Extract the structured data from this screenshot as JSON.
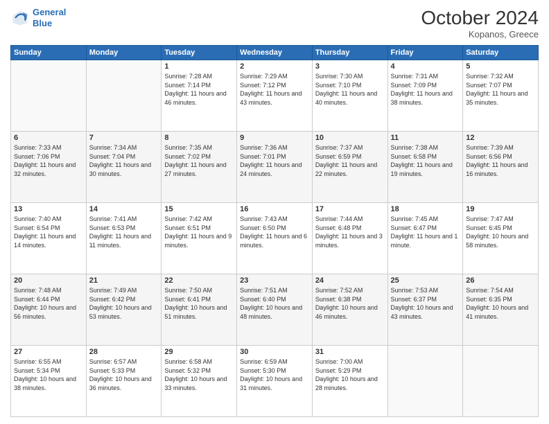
{
  "header": {
    "logo_line1": "General",
    "logo_line2": "Blue",
    "month_title": "October 2024",
    "location": "Kopanos, Greece"
  },
  "days_of_week": [
    "Sunday",
    "Monday",
    "Tuesday",
    "Wednesday",
    "Thursday",
    "Friday",
    "Saturday"
  ],
  "weeks": [
    [
      {
        "day": "",
        "info": ""
      },
      {
        "day": "",
        "info": ""
      },
      {
        "day": "1",
        "info": "Sunrise: 7:28 AM\nSunset: 7:14 PM\nDaylight: 11 hours and 46 minutes."
      },
      {
        "day": "2",
        "info": "Sunrise: 7:29 AM\nSunset: 7:12 PM\nDaylight: 11 hours and 43 minutes."
      },
      {
        "day": "3",
        "info": "Sunrise: 7:30 AM\nSunset: 7:10 PM\nDaylight: 11 hours and 40 minutes."
      },
      {
        "day": "4",
        "info": "Sunrise: 7:31 AM\nSunset: 7:09 PM\nDaylight: 11 hours and 38 minutes."
      },
      {
        "day": "5",
        "info": "Sunrise: 7:32 AM\nSunset: 7:07 PM\nDaylight: 11 hours and 35 minutes."
      }
    ],
    [
      {
        "day": "6",
        "info": "Sunrise: 7:33 AM\nSunset: 7:06 PM\nDaylight: 11 hours and 32 minutes."
      },
      {
        "day": "7",
        "info": "Sunrise: 7:34 AM\nSunset: 7:04 PM\nDaylight: 11 hours and 30 minutes."
      },
      {
        "day": "8",
        "info": "Sunrise: 7:35 AM\nSunset: 7:02 PM\nDaylight: 11 hours and 27 minutes."
      },
      {
        "day": "9",
        "info": "Sunrise: 7:36 AM\nSunset: 7:01 PM\nDaylight: 11 hours and 24 minutes."
      },
      {
        "day": "10",
        "info": "Sunrise: 7:37 AM\nSunset: 6:59 PM\nDaylight: 11 hours and 22 minutes."
      },
      {
        "day": "11",
        "info": "Sunrise: 7:38 AM\nSunset: 6:58 PM\nDaylight: 11 hours and 19 minutes."
      },
      {
        "day": "12",
        "info": "Sunrise: 7:39 AM\nSunset: 6:56 PM\nDaylight: 11 hours and 16 minutes."
      }
    ],
    [
      {
        "day": "13",
        "info": "Sunrise: 7:40 AM\nSunset: 6:54 PM\nDaylight: 11 hours and 14 minutes."
      },
      {
        "day": "14",
        "info": "Sunrise: 7:41 AM\nSunset: 6:53 PM\nDaylight: 11 hours and 11 minutes."
      },
      {
        "day": "15",
        "info": "Sunrise: 7:42 AM\nSunset: 6:51 PM\nDaylight: 11 hours and 9 minutes."
      },
      {
        "day": "16",
        "info": "Sunrise: 7:43 AM\nSunset: 6:50 PM\nDaylight: 11 hours and 6 minutes."
      },
      {
        "day": "17",
        "info": "Sunrise: 7:44 AM\nSunset: 6:48 PM\nDaylight: 11 hours and 3 minutes."
      },
      {
        "day": "18",
        "info": "Sunrise: 7:45 AM\nSunset: 6:47 PM\nDaylight: 11 hours and 1 minute."
      },
      {
        "day": "19",
        "info": "Sunrise: 7:47 AM\nSunset: 6:45 PM\nDaylight: 10 hours and 58 minutes."
      }
    ],
    [
      {
        "day": "20",
        "info": "Sunrise: 7:48 AM\nSunset: 6:44 PM\nDaylight: 10 hours and 56 minutes."
      },
      {
        "day": "21",
        "info": "Sunrise: 7:49 AM\nSunset: 6:42 PM\nDaylight: 10 hours and 53 minutes."
      },
      {
        "day": "22",
        "info": "Sunrise: 7:50 AM\nSunset: 6:41 PM\nDaylight: 10 hours and 51 minutes."
      },
      {
        "day": "23",
        "info": "Sunrise: 7:51 AM\nSunset: 6:40 PM\nDaylight: 10 hours and 48 minutes."
      },
      {
        "day": "24",
        "info": "Sunrise: 7:52 AM\nSunset: 6:38 PM\nDaylight: 10 hours and 46 minutes."
      },
      {
        "day": "25",
        "info": "Sunrise: 7:53 AM\nSunset: 6:37 PM\nDaylight: 10 hours and 43 minutes."
      },
      {
        "day": "26",
        "info": "Sunrise: 7:54 AM\nSunset: 6:35 PM\nDaylight: 10 hours and 41 minutes."
      }
    ],
    [
      {
        "day": "27",
        "info": "Sunrise: 6:55 AM\nSunset: 5:34 PM\nDaylight: 10 hours and 38 minutes."
      },
      {
        "day": "28",
        "info": "Sunrise: 6:57 AM\nSunset: 5:33 PM\nDaylight: 10 hours and 36 minutes."
      },
      {
        "day": "29",
        "info": "Sunrise: 6:58 AM\nSunset: 5:32 PM\nDaylight: 10 hours and 33 minutes."
      },
      {
        "day": "30",
        "info": "Sunrise: 6:59 AM\nSunset: 5:30 PM\nDaylight: 10 hours and 31 minutes."
      },
      {
        "day": "31",
        "info": "Sunrise: 7:00 AM\nSunset: 5:29 PM\nDaylight: 10 hours and 28 minutes."
      },
      {
        "day": "",
        "info": ""
      },
      {
        "day": "",
        "info": ""
      }
    ]
  ]
}
